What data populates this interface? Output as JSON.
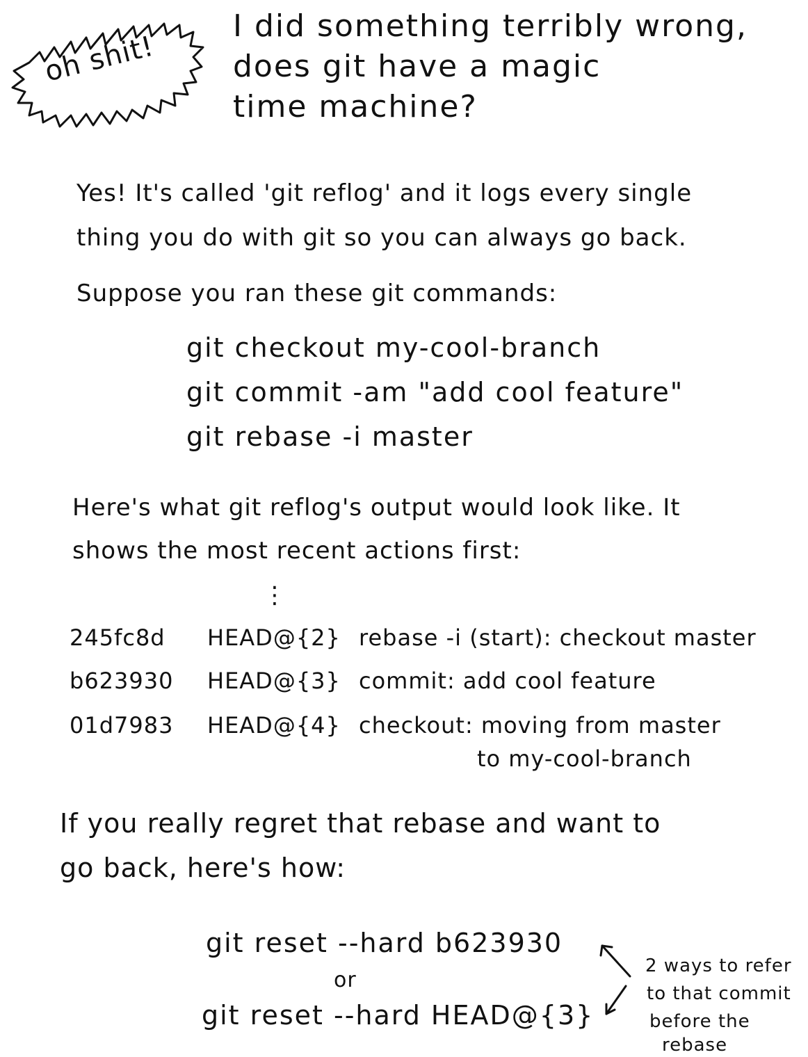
{
  "badge": {
    "text": "oh shit!"
  },
  "title": {
    "lines": [
      "I did something terribly wrong,",
      "does git have a magic",
      "time machine?"
    ]
  },
  "intro": {
    "lines": [
      "Yes! It's called 'git reflog' and it logs every single",
      "thing you do with git so you can always go back."
    ]
  },
  "suppose": {
    "text": "Suppose you ran these git commands:"
  },
  "commands": [
    "git checkout my-cool-branch",
    "git commit -am \"add cool feature\"",
    "git rebase -i master"
  ],
  "output_intro": {
    "lines": [
      "Here's what git reflog's output would look like. It",
      "shows the most recent actions first:"
    ]
  },
  "ellipsis": "⋮",
  "reflog": [
    {
      "hash": "245fc8d",
      "ref": "HEAD@{2}",
      "message": "rebase -i (start): checkout master"
    },
    {
      "hash": "b623930",
      "ref": "HEAD@{3}",
      "message": "commit: add cool feature"
    },
    {
      "hash": "01d7983",
      "ref": "HEAD@{4}",
      "message": "checkout: moving from master",
      "message_cont": "to my-cool-branch"
    }
  ],
  "regret": {
    "lines": [
      "If you really regret that rebase and want to",
      "go back, here's how:"
    ]
  },
  "reset": {
    "cmd1": "git reset --hard b623930",
    "or": "or",
    "cmd2": "git reset --hard HEAD@{3}"
  },
  "note": {
    "lines": [
      "2 ways to refer",
      "to that commit",
      "before the",
      "rebase"
    ]
  }
}
